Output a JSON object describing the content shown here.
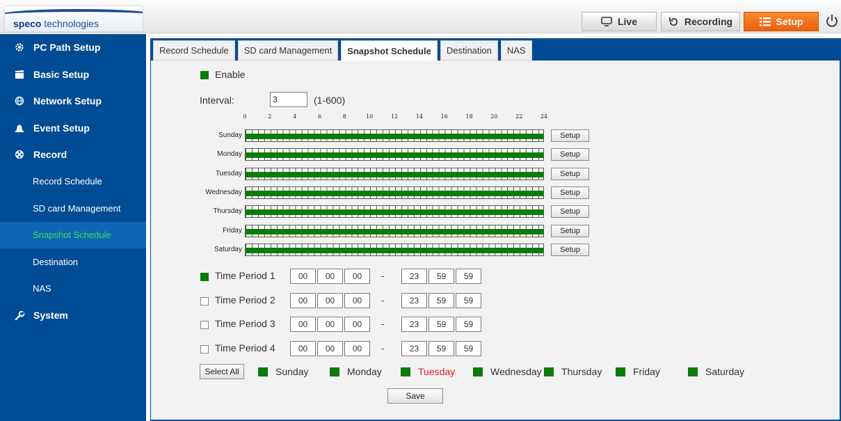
{
  "header": {
    "logo": {
      "brand": "speco",
      "rest": " technologies"
    },
    "nav": [
      {
        "label": "Live",
        "icon": "monitor-icon"
      },
      {
        "label": "Recording",
        "icon": "refresh-icon"
      },
      {
        "label": "Setup",
        "icon": "list-icon"
      }
    ],
    "power_icon": "power-icon",
    "colors": {
      "setup_active": "#ec5f0c",
      "sidebar": "#004c94",
      "active_text": "#38e05a"
    }
  },
  "sidebar": {
    "items": [
      {
        "label": "PC Path Setup",
        "icon": "gear-icon",
        "type": "main"
      },
      {
        "label": "Basic Setup",
        "icon": "clapper-icon",
        "type": "main"
      },
      {
        "label": "Network Setup",
        "icon": "globe-icon",
        "type": "main"
      },
      {
        "label": "Event Setup",
        "icon": "bell-icon",
        "type": "main"
      },
      {
        "label": "Record",
        "icon": "film-reel-icon",
        "type": "main"
      },
      {
        "label": "Record Schedule",
        "type": "sub"
      },
      {
        "label": "SD card Management",
        "type": "sub"
      },
      {
        "label": "Snapshot Schedule",
        "type": "sub",
        "active": true
      },
      {
        "label": "Destination",
        "type": "sub"
      },
      {
        "label": "NAS",
        "type": "sub"
      },
      {
        "label": "System",
        "icon": "wrench-icon",
        "type": "main"
      }
    ]
  },
  "tabs": [
    {
      "label": "Record Schedule"
    },
    {
      "label": "SD card Management"
    },
    {
      "label": "Snapshot Schedule",
      "active": true
    },
    {
      "label": "Destination"
    },
    {
      "label": "NAS"
    }
  ],
  "form": {
    "enable_label": "Enable",
    "enable_checked": true,
    "interval_label": "Interval:",
    "interval_value": "3",
    "interval_range": "(1-600)"
  },
  "schedule": {
    "hour_ticks": [
      "0",
      "2",
      "4",
      "6",
      "8",
      "10",
      "12",
      "14",
      "16",
      "18",
      "20",
      "22",
      "24"
    ],
    "days": [
      {
        "label": "Sunday",
        "coverage": 1.0
      },
      {
        "label": "Monday",
        "coverage": 1.0
      },
      {
        "label": "Tuesday",
        "coverage": 1.0
      },
      {
        "label": "Wednesday",
        "coverage": 1.0
      },
      {
        "label": "Thursday",
        "coverage": 1.0
      },
      {
        "label": "Friday",
        "coverage": 1.0
      },
      {
        "label": "Saturday",
        "coverage": 1.0
      }
    ],
    "setup_label": "Setup"
  },
  "time_periods": [
    {
      "label": "Time Period 1",
      "checked": true,
      "start": [
        "00",
        "00",
        "00"
      ],
      "end": [
        "23",
        "59",
        "59"
      ]
    },
    {
      "label": "Time Period 2",
      "checked": false,
      "start": [
        "00",
        "00",
        "00"
      ],
      "end": [
        "23",
        "59",
        "59"
      ]
    },
    {
      "label": "Time Period 3",
      "checked": false,
      "start": [
        "00",
        "00",
        "00"
      ],
      "end": [
        "23",
        "59",
        "59"
      ]
    },
    {
      "label": "Time Period 4",
      "checked": false,
      "start": [
        "00",
        "00",
        "00"
      ],
      "end": [
        "23",
        "59",
        "59"
      ]
    }
  ],
  "separator": "-",
  "day_select": {
    "select_all_label": "Select All",
    "days": [
      {
        "label": "Sunday",
        "checked": true
      },
      {
        "label": "Monday",
        "checked": true
      },
      {
        "label": "Tuesday",
        "checked": true,
        "highlight": true
      },
      {
        "label": "Wednesday",
        "checked": true
      },
      {
        "label": "Thursday",
        "checked": true
      },
      {
        "label": "Friday",
        "checked": true
      },
      {
        "label": "Saturday",
        "checked": true
      }
    ]
  },
  "save_label": "Save"
}
